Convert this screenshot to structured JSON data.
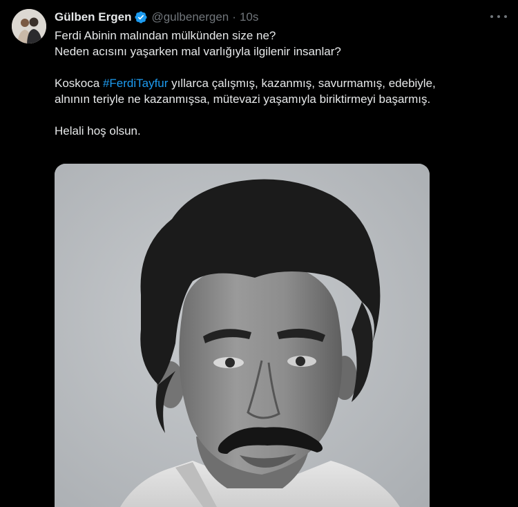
{
  "tweet": {
    "author": {
      "display_name": "Gülben Ergen",
      "handle": "@gulbenergen",
      "verified": true,
      "verified_color": "#1d9bf0"
    },
    "separator": "·",
    "time": "10s",
    "text": {
      "line1": "Ferdi Abinin malından mülkünden size ne?",
      "line2": "Neden acısını yaşarken mal varlığıyla ilgilenir insanlar?",
      "line3_prefix": "Koskoca ",
      "hashtag": "#FerdiTayfur",
      "line3_suffix": " yıllarca çalışmış, kazanmış, savurmamış, edebiyle,",
      "line4": "alnının teriyle ne kazanmışsa, mütevazi yaşamıyla biriktirmeyi başarmış.",
      "line5": "Helali hoş olsun."
    },
    "hashtag_color": "#1d9bf0",
    "icons": {
      "verified": "verified-badge-icon",
      "more": "more-options-icon"
    }
  }
}
